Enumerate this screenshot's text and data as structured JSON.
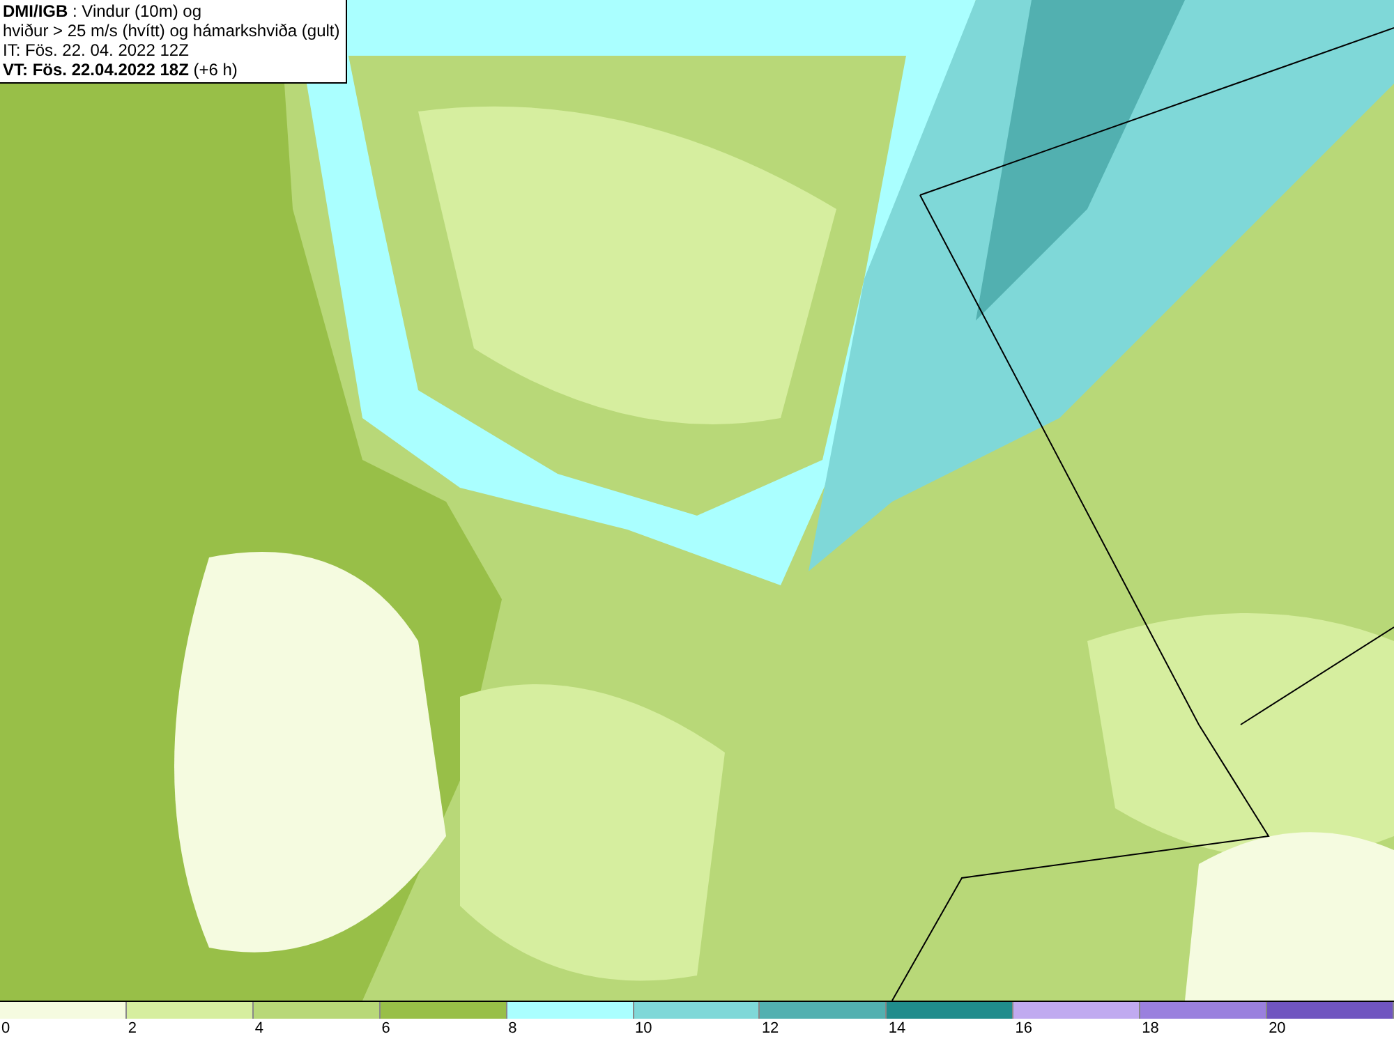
{
  "caption": {
    "lines": [
      "**DMI/IGB** : Vindur (10m) og",
      "hviður > 25 m/s (hvítt) og hámarkshviða (gult)",
      "IT: Fös. 22. 04. 2022 12Z",
      "**VT: Fös. 22.04.2022 18Z** (+6 h)"
    ]
  },
  "legend": {
    "bins": [
      {
        "label": "0",
        "color": "#f5fbe0"
      },
      {
        "label": "2",
        "color": "#d6ee9f"
      },
      {
        "label": "4",
        "color": "#b8d878"
      },
      {
        "label": "6",
        "color": "#98bf48"
      },
      {
        "label": "8",
        "color": "#aaffff"
      },
      {
        "label": "10",
        "color": "#7fd8d8"
      },
      {
        "label": "12",
        "color": "#52b0b0"
      },
      {
        "label": "14",
        "color": "#208c8c"
      },
      {
        "label": "16",
        "color": "#c0aaf0"
      },
      {
        "label": "18",
        "color": "#9a80de"
      },
      {
        "label": "20",
        "color": "#7055c0"
      }
    ]
  }
}
